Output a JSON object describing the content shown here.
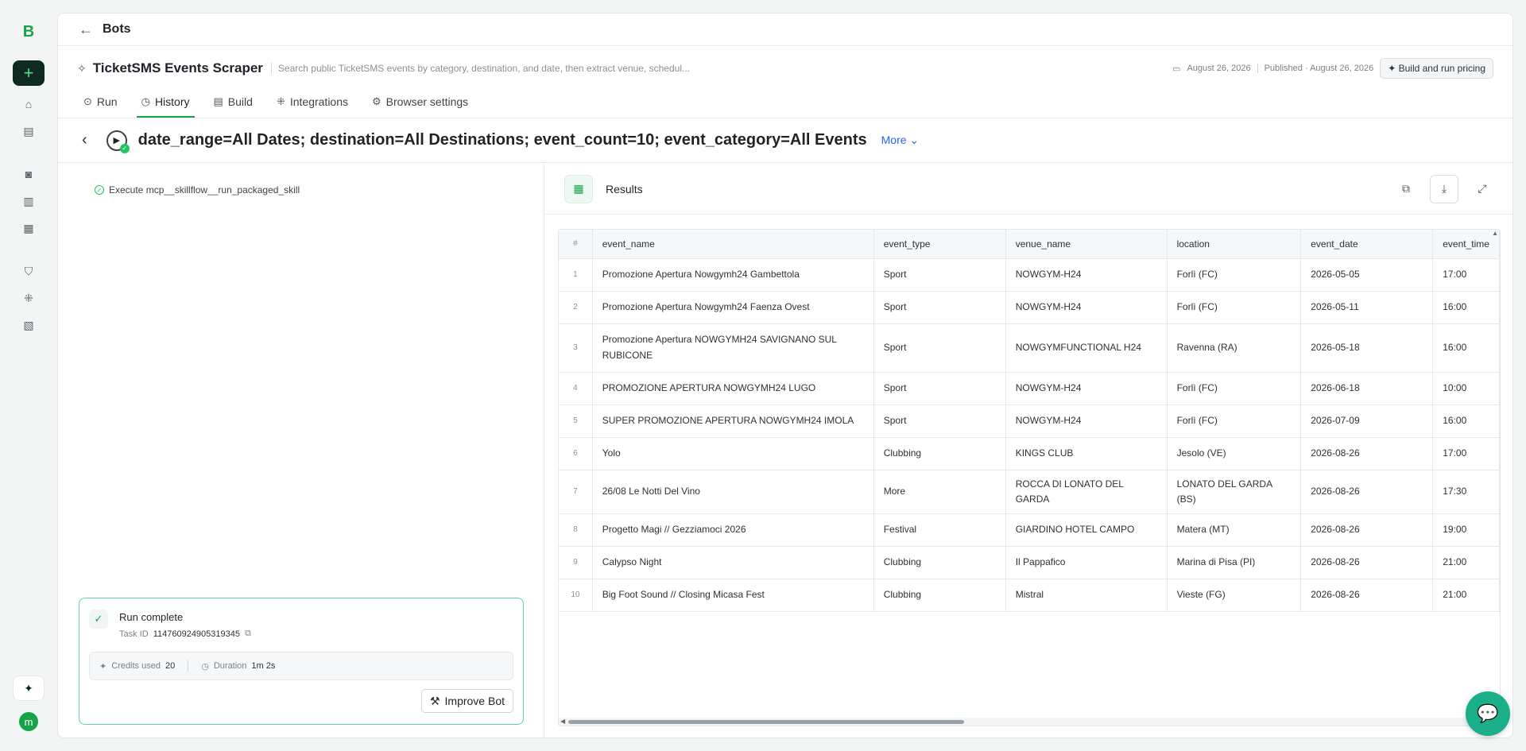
{
  "rail": {
    "logo": "B",
    "new_label": "+",
    "icons": [
      "home-icon",
      "dashboard-icon",
      "bot-icon",
      "book-icon",
      "library-icon",
      "shield-icon",
      "grid-icon",
      "database-icon"
    ],
    "spark_label": "✦",
    "avatar": "m"
  },
  "topbar": {
    "back_label": "←",
    "title": "Bots"
  },
  "bot": {
    "name": "TicketSMS Events Scraper",
    "description": "Search public TicketSMS events by category, destination, and date, then extract venue, schedul...",
    "date": "August 26, 2026",
    "published": "Published · August 26, 2026",
    "pricing_label": "Build and run pricing"
  },
  "tabs": [
    {
      "label": "Run",
      "icon": "play-icon"
    },
    {
      "label": "History",
      "icon": "clock-icon"
    },
    {
      "label": "Build",
      "icon": "layout-icon"
    },
    {
      "label": "Integrations",
      "icon": "grid-icon"
    },
    {
      "label": "Browser settings",
      "icon": "gear-icon"
    }
  ],
  "run": {
    "title": "date_range=All Dates; destination=All Destinations; event_count=10; event_category=All Events",
    "more_label": "More"
  },
  "steps": [
    {
      "label": "Execute mcp__skillflow__run_packaged_skill"
    }
  ],
  "card": {
    "title": "Run complete",
    "task_label": "Task ID",
    "task_id": "114760924905319345",
    "credits_label": "Credits used",
    "credits": "20",
    "duration_label": "Duration",
    "duration": "1m 2s",
    "improve_label": "Improve Bot"
  },
  "results": {
    "title": "Results",
    "columns": [
      "#",
      "event_name",
      "event_type",
      "venue_name",
      "location",
      "event_date",
      "event_time"
    ],
    "rows": [
      [
        "1",
        "Promozione Apertura Nowgymh24 Gambettola",
        "Sport",
        "NOWGYM-H24",
        "Forlì (FC)",
        "2026-05-05",
        "17:00"
      ],
      [
        "2",
        "Promozione Apertura Nowgymh24 Faenza Ovest",
        "Sport",
        "NOWGYM-H24",
        "Forlì (FC)",
        "2026-05-11",
        "16:00"
      ],
      [
        "3",
        "Promozione Apertura NOWGYMH24 SAVIGNANO SUL RUBICONE",
        "Sport",
        "NOWGYMFUNCTIONAL H24",
        "Ravenna (RA)",
        "2026-05-18",
        "16:00"
      ],
      [
        "4",
        "PROMOZIONE APERTURA NOWGYMH24 LUGO",
        "Sport",
        "NOWGYM-H24",
        "Forlì (FC)",
        "2026-06-18",
        "10:00"
      ],
      [
        "5",
        "SUPER PROMOZIONE APERTURA NOWGYMH24 IMOLA",
        "Sport",
        "NOWGYM-H24",
        "Forlì (FC)",
        "2026-07-09",
        "16:00"
      ],
      [
        "6",
        "Yolo",
        "Clubbing",
        "KINGS CLUB",
        "Jesolo (VE)",
        "2026-08-26",
        "17:00"
      ],
      [
        "7",
        "26/08 Le Notti Del Vino",
        "More",
        "ROCCA DI LONATO DEL GARDA",
        "LONATO DEL GARDA (BS)",
        "2026-08-26",
        "17:30"
      ],
      [
        "8",
        "Progetto Magi // Gezziamoci 2026",
        "Festival",
        "GIARDINO HOTEL CAMPO",
        "Matera (MT)",
        "2026-08-26",
        "19:00"
      ],
      [
        "9",
        "Calypso Night",
        "Clubbing",
        "Il Pappafico",
        "Marina di Pisa (PI)",
        "2026-08-26",
        "21:00"
      ],
      [
        "10",
        "Big Foot Sound // Closing Micasa Fest",
        "Clubbing",
        "Mistral",
        "Vieste (FG)",
        "2026-08-26",
        "21:00"
      ]
    ]
  }
}
